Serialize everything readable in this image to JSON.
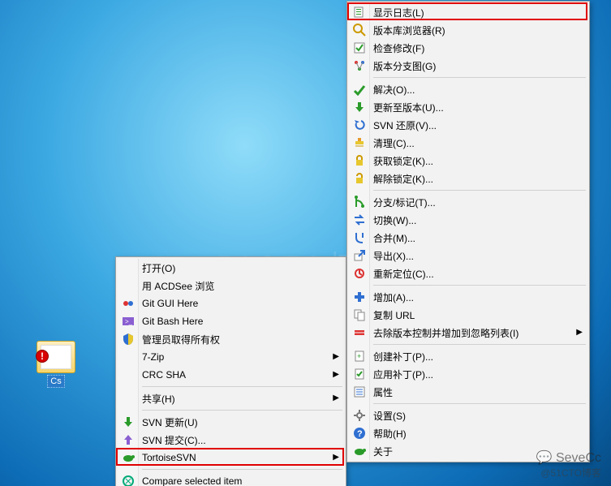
{
  "desktop": {
    "folder_label": "Cs",
    "overlay_mark": "!"
  },
  "menu1": {
    "items": [
      {
        "id": "open",
        "label": "打开(O)",
        "icon": "",
        "sub": false
      },
      {
        "id": "acdsee",
        "label": "用 ACDSee 浏览",
        "icon": "",
        "sub": false
      },
      {
        "id": "gitgui",
        "label": "Git GUI Here",
        "icon": "git-gui",
        "sub": false
      },
      {
        "id": "gitbash",
        "label": "Git Bash Here",
        "icon": "git-bash",
        "sub": false
      },
      {
        "id": "admin",
        "label": "管理员取得所有权",
        "icon": "shield",
        "sub": false
      },
      {
        "id": "7zip",
        "label": "7-Zip",
        "icon": "",
        "sub": true
      },
      {
        "id": "crcsha",
        "label": "CRC SHA",
        "icon": "",
        "sub": true
      },
      {
        "sep": true
      },
      {
        "id": "share",
        "label": "共享(H)",
        "icon": "",
        "sub": true
      },
      {
        "sep": true
      },
      {
        "id": "svnupd",
        "label": "SVN 更新(U)",
        "icon": "svn-update",
        "sub": false
      },
      {
        "id": "svncommit",
        "label": "SVN 提交(C)...",
        "icon": "svn-commit",
        "sub": false
      },
      {
        "id": "tsvn",
        "label": "TortoiseSVN",
        "icon": "tortoise",
        "sub": true,
        "highlight": true
      },
      {
        "sep": true
      },
      {
        "id": "compare",
        "label": "Compare selected item",
        "icon": "compare",
        "sub": false
      }
    ]
  },
  "menu2": {
    "items": [
      {
        "id": "showlog",
        "label": "显示日志(L)",
        "icon": "log",
        "highlight": true
      },
      {
        "id": "repo",
        "label": "版本库浏览器(R)",
        "icon": "repo"
      },
      {
        "id": "check",
        "label": "检查修改(F)",
        "icon": "check"
      },
      {
        "id": "revgraph",
        "label": "版本分支图(G)",
        "icon": "graph"
      },
      {
        "sep": true
      },
      {
        "id": "resolve",
        "label": "解决(O)...",
        "icon": "resolve"
      },
      {
        "id": "update",
        "label": "更新至版本(U)...",
        "icon": "update"
      },
      {
        "id": "revert",
        "label": "SVN 还原(V)...",
        "icon": "revert"
      },
      {
        "id": "cleanup",
        "label": "清理(C)...",
        "icon": "cleanup"
      },
      {
        "id": "getlock",
        "label": "获取锁定(K)...",
        "icon": "lock"
      },
      {
        "id": "rellock",
        "label": "解除锁定(K)...",
        "icon": "unlock"
      },
      {
        "sep": true
      },
      {
        "id": "branch",
        "label": "分支/标记(T)...",
        "icon": "branch"
      },
      {
        "id": "switch",
        "label": "切换(W)...",
        "icon": "switch"
      },
      {
        "id": "merge",
        "label": "合并(M)...",
        "icon": "merge"
      },
      {
        "id": "export",
        "label": "导出(X)...",
        "icon": "export"
      },
      {
        "id": "relocate",
        "label": "重新定位(C)...",
        "icon": "relocate"
      },
      {
        "sep": true
      },
      {
        "id": "add",
        "label": "增加(A)...",
        "icon": "add"
      },
      {
        "id": "copyurl",
        "label": "复制 URL",
        "icon": "copy"
      },
      {
        "id": "unversion",
        "label": "去除版本控制并增加到忽略列表(I)",
        "icon": "ignore",
        "sub": true
      },
      {
        "sep": true
      },
      {
        "id": "cpatch",
        "label": "创建补丁(P)...",
        "icon": "cpatch"
      },
      {
        "id": "apatch",
        "label": "应用补丁(P)...",
        "icon": "apatch"
      },
      {
        "id": "props",
        "label": "属性",
        "icon": "props"
      },
      {
        "sep": true
      },
      {
        "id": "settings",
        "label": "设置(S)",
        "icon": "settings"
      },
      {
        "id": "help",
        "label": "帮助(H)",
        "icon": "help"
      },
      {
        "id": "about",
        "label": "关于",
        "icon": "about"
      }
    ]
  },
  "watermark": {
    "logo_text": "💬 SeveCc",
    "sub_text": "@51CTO博客",
    "center": "51CTO博客"
  }
}
